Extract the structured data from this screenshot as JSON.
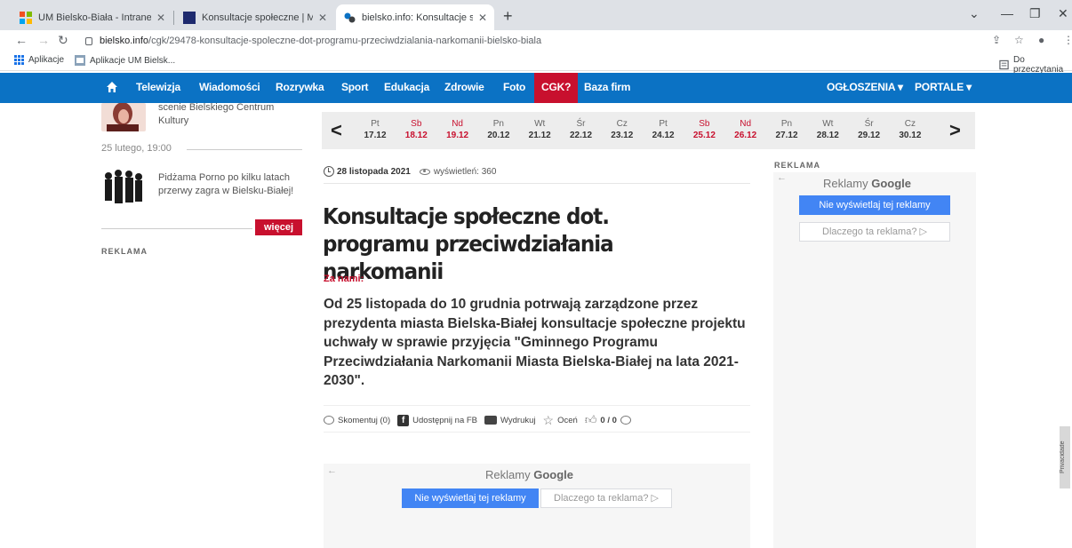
{
  "browser": {
    "tabs": [
      {
        "title": "UM Bielsko-Biała - Intranet",
        "close": "✕"
      },
      {
        "title": "Konsultacje społeczne | Magazyn",
        "close": "✕"
      },
      {
        "title": "bielsko.info: Konsultacje społeczne",
        "close": "✕"
      }
    ],
    "new_tab": "+",
    "url_host": "bielsko.info",
    "url_path": "/cgk/29478-konsultacje-spoleczne-dot-programu-przeciwdzialania-narkomanii-bielsko-biala",
    "bookmarks": [
      "Aplikacje",
      "Aplikacje UM Bielsk..."
    ],
    "reading_list": "Do przeczytania"
  },
  "nav": {
    "items": [
      "Telewizja",
      "Wiadomości",
      "Rozrywka",
      "Sport",
      "Edukacja",
      "Zdrowie",
      "Foto",
      "CGK?",
      "Baza firm"
    ],
    "right": [
      "OGŁOSZENIA ▾",
      "PORTALE ▾"
    ]
  },
  "sidebar": {
    "item1_text": "scenie Bielskiego Centrum Kultury",
    "date_header": "25 lutego, 19:00",
    "item2_text": "Pidżama Porno po kilku latach przerwy zagra w Bielsku-Białej!",
    "more_label": "więcej",
    "ad_label": "REKLAMA"
  },
  "datestrip": {
    "days": [
      {
        "name": "Pt",
        "date": "17.12",
        "red": false
      },
      {
        "name": "Sb",
        "date": "18.12",
        "red": true
      },
      {
        "name": "Nd",
        "date": "19.12",
        "red": true
      },
      {
        "name": "Pn",
        "date": "20.12",
        "red": false
      },
      {
        "name": "Wt",
        "date": "21.12",
        "red": false
      },
      {
        "name": "Śr",
        "date": "22.12",
        "red": false
      },
      {
        "name": "Cz",
        "date": "23.12",
        "red": false
      },
      {
        "name": "Pt",
        "date": "24.12",
        "red": false
      },
      {
        "name": "Sb",
        "date": "25.12",
        "red": true
      },
      {
        "name": "Nd",
        "date": "26.12",
        "red": true
      },
      {
        "name": "Pn",
        "date": "27.12",
        "red": false
      },
      {
        "name": "Wt",
        "date": "28.12",
        "red": false
      },
      {
        "name": "Śr",
        "date": "29.12",
        "red": false
      },
      {
        "name": "Cz",
        "date": "30.12",
        "red": false
      }
    ]
  },
  "article": {
    "date": "28 listopada 2021",
    "views": "wyświetleń: 360",
    "title": "Konsultacje społeczne dot. programu przeciwdziałania narkomanii",
    "kicker": "Za nami:",
    "lead": "Od 25 listopada do 10 grudnia potrwają zarządzone przez prezydenta miasta Bielska-Białej konsultacje społeczne projektu uchwały w sprawie przyjęcia \"Gminnego Programu Przeciwdziałania Narkomanii Miasta Bielska-Białej na lata 2021-2030\".",
    "share": {
      "comment": "Skomentuj (0)",
      "facebook": "Udostępnij na FB",
      "print": "Wydrukuj",
      "rate": "Oceń",
      "score": "0 / 0"
    }
  },
  "right_ad": {
    "label": "REKLAMA",
    "title_prefix": "Reklamy",
    "title_brand": "Google",
    "hide": "Nie wyświetlaj tej reklamy",
    "why": "Dlaczego ta reklama? ▷"
  },
  "bottom_ad": {
    "title_prefix": "Reklamy",
    "title_brand": "Google",
    "hide": "Nie wyświetlaj tej reklamy",
    "why": "Dlaczego ta reklama? ▷"
  },
  "privacy": "Privacidade",
  "colors": {
    "nav_blue": "#0b72c4",
    "accent_red": "#c8102e",
    "google_blue": "#4285f4"
  }
}
